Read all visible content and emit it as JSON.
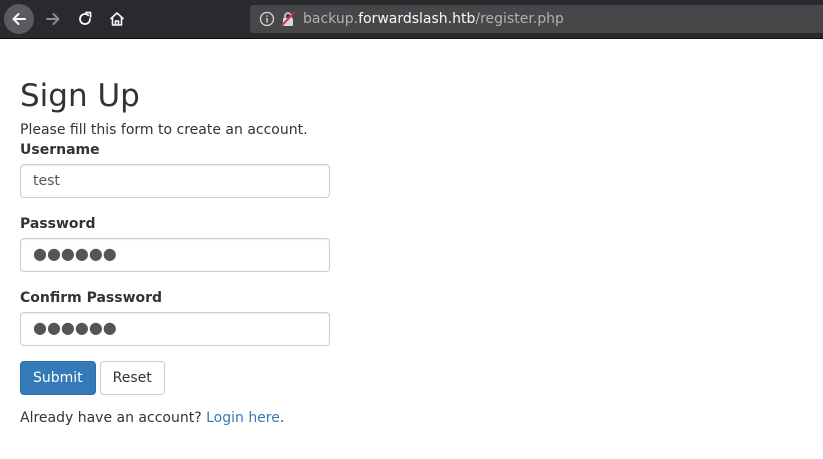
{
  "browser": {
    "url_host_prefix": "backup.",
    "url_host_domain": "forwardslash.htb",
    "url_path": "/register.php"
  },
  "form": {
    "title": "Sign Up",
    "subtitle": "Please fill this form to create an account.",
    "username_label": "Username",
    "username_value": "test",
    "password_label": "Password",
    "password_value": "●●●●●●",
    "confirm_label": "Confirm Password",
    "confirm_value": "●●●●●●",
    "submit_label": "Submit",
    "reset_label": "Reset",
    "footer_prefix": "Already have an account? ",
    "login_link": "Login here",
    "footer_suffix": "."
  },
  "colors": {
    "toolbar": "#2a2a2e",
    "urlbar": "#474749",
    "primary": "#337ab7",
    "link": "#337ab7"
  },
  "icons": {
    "back": "arrow-left-icon",
    "forward": "arrow-right-icon",
    "reload": "reload-icon",
    "home": "home-icon",
    "info": "info-icon",
    "insecure": "insecure-lock-icon"
  }
}
